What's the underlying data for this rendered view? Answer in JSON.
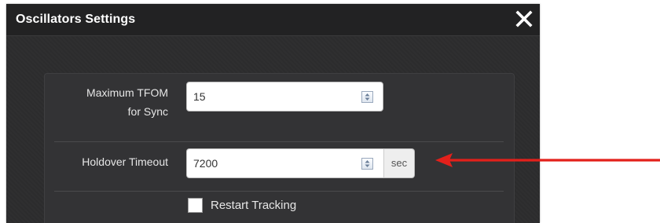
{
  "dialog": {
    "title": "Oscillators Settings",
    "close_icon": "close-icon"
  },
  "form": {
    "max_tfom": {
      "label_line1": "Maximum TFOM",
      "label_line2": "for Sync",
      "value": "15",
      "spinner_icon": "spinner-arrows-icon"
    },
    "holdover": {
      "label": "Holdover Timeout",
      "value": "7200",
      "unit": "sec",
      "spinner_icon": "spinner-arrows-icon"
    },
    "restart_tracking": {
      "label": "Restart Tracking",
      "checked": false
    }
  },
  "annotation": {
    "arrow_icon": "red-arrow-icon",
    "arrow_color": "#e3201b"
  },
  "colors": {
    "titlebar": "#222223",
    "dialog_bg": "#2d2d2e",
    "panel_bg": "#333335",
    "text_light": "#e6e6e6"
  }
}
